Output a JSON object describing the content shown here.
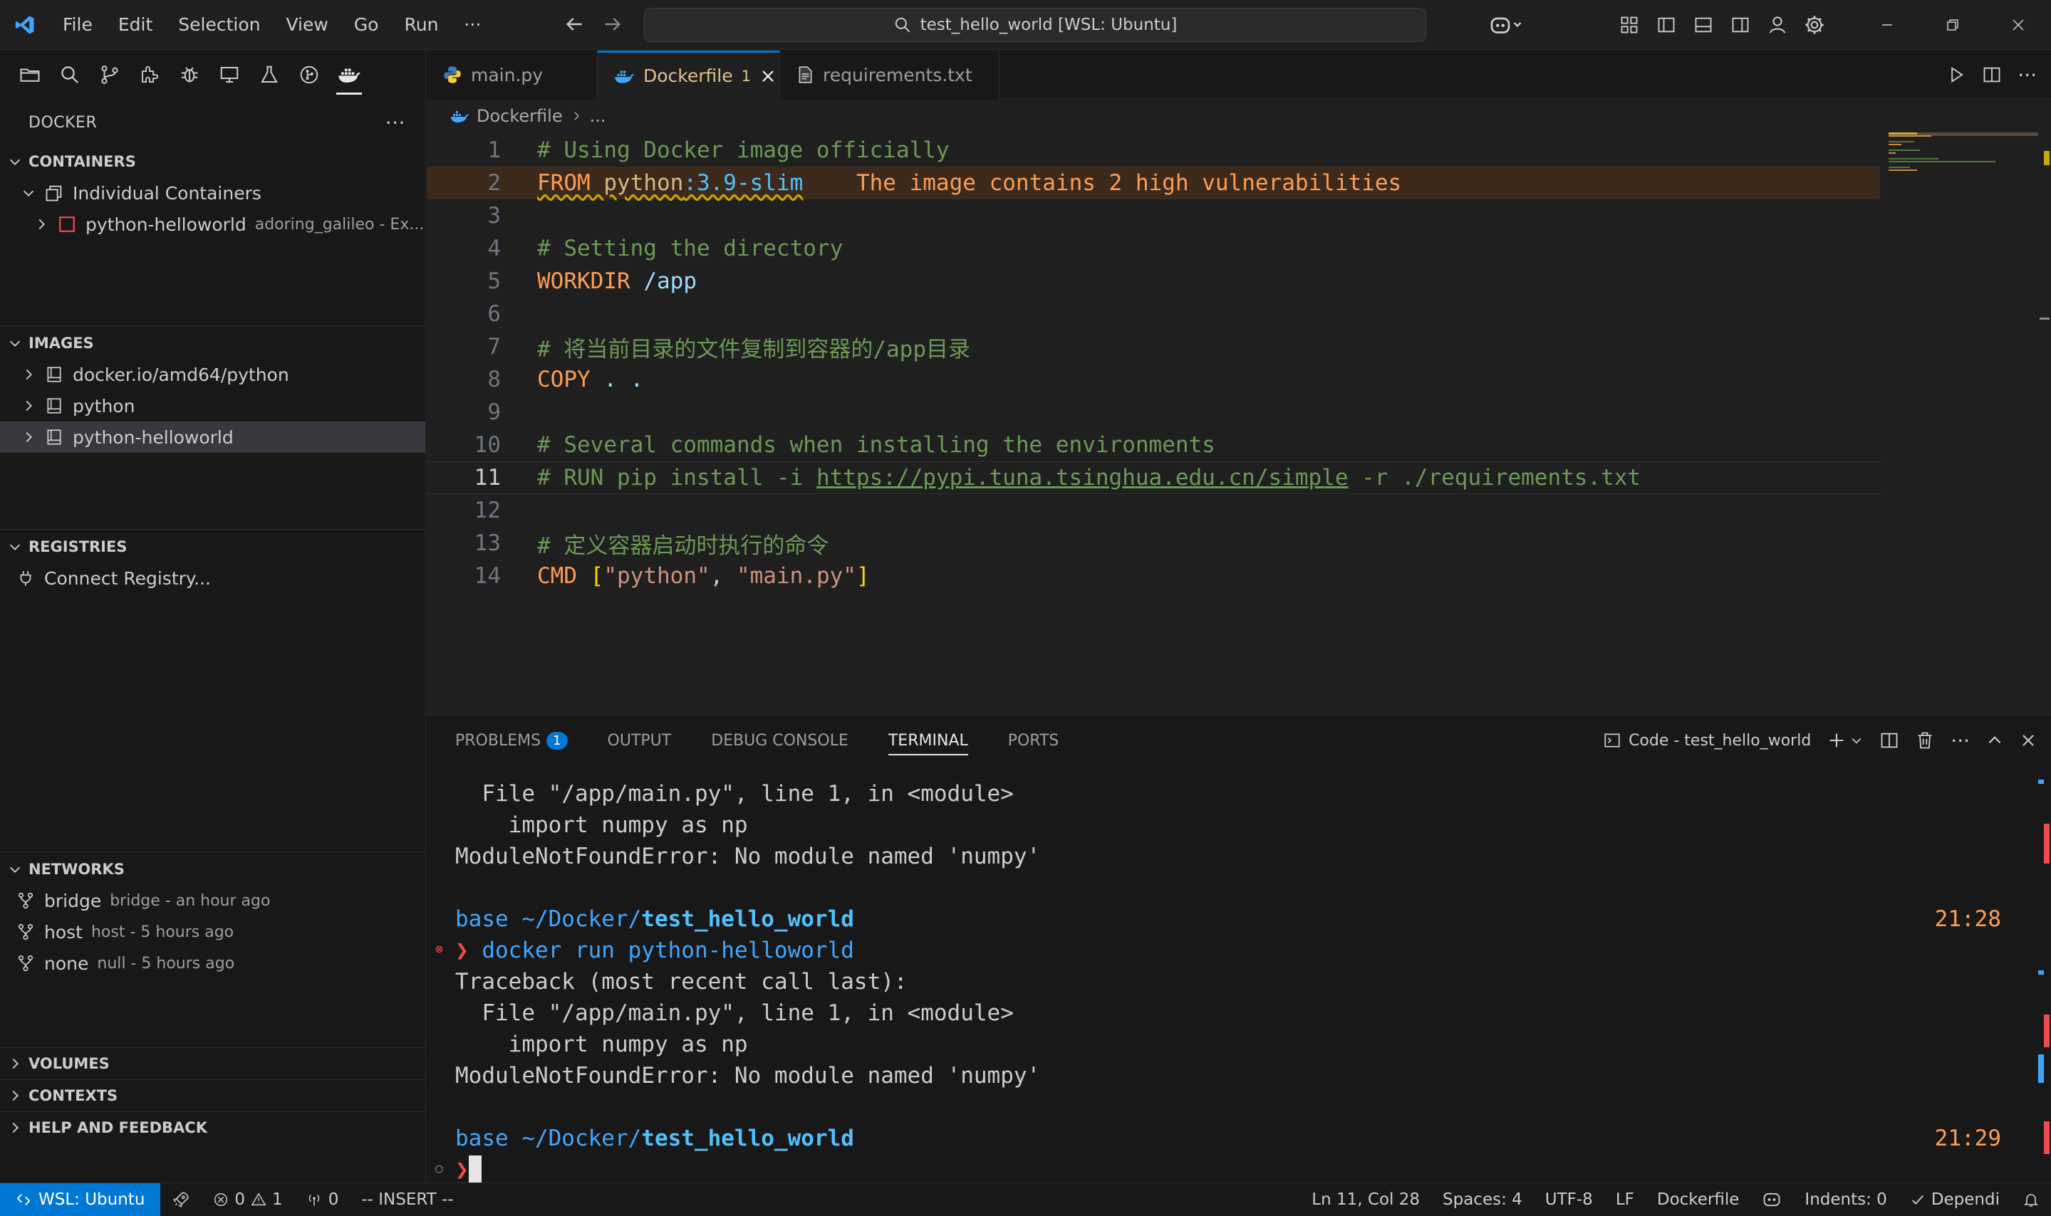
{
  "titlebar": {
    "menu": [
      "File",
      "Edit",
      "Selection",
      "View",
      "Go",
      "Run",
      "···"
    ],
    "search_text": "test_hello_world [WSL: Ubuntu]"
  },
  "sidebar": {
    "title": "DOCKER",
    "more": "···",
    "containers": {
      "header": "CONTAINERS",
      "group": "Individual Containers",
      "items": [
        {
          "name": "python-helloworld",
          "desc": "adoring_galileo - Ex..."
        }
      ]
    },
    "images": {
      "header": "IMAGES",
      "items": [
        "docker.io/amd64/python",
        "python",
        "python-helloworld"
      ]
    },
    "registries": {
      "header": "REGISTRIES",
      "connect": "Connect Registry..."
    },
    "networks": {
      "header": "NETWORKS",
      "items": [
        {
          "name": "bridge",
          "desc": "bridge - an hour ago"
        },
        {
          "name": "host",
          "desc": "host - 5 hours ago"
        },
        {
          "name": "none",
          "desc": "null - 5 hours ago"
        }
      ]
    },
    "volumes": "VOLUMES",
    "contexts": "CONTEXTS",
    "help": "HELP AND FEEDBACK"
  },
  "editor": {
    "tabs": [
      {
        "label": "main.py"
      },
      {
        "label": "Dockerfile",
        "badge": "1"
      },
      {
        "label": "requirements.txt"
      }
    ],
    "breadcrumb": {
      "file": "Dockerfile",
      "rest": "..."
    },
    "line_numbers": [
      "1",
      "2",
      "3",
      "4",
      "5",
      "6",
      "7",
      "8",
      "9",
      "10",
      "11",
      "12",
      "13",
      "14"
    ],
    "code": {
      "l1": "# Using Docker image officially",
      "l2_kw": "FROM",
      "l2_img": "python",
      "l2_tag": ":3.9-slim",
      "l2_inlay": "The image contains 2 high vulnerabilities",
      "l4": "# Setting the directory",
      "l5_kw": "WORKDIR",
      "l5_arg": "/app",
      "l7": "# 将当前目录的文件复制到容器的/app目录",
      "l8_kw": "COPY",
      "l8_arg": ". .",
      "l10": "# Several commands when installing the environments",
      "l11_a": "# RUN pip install -i ",
      "l11_url": "https://pypi.tuna.tsinghua.edu.cn/simple",
      "l11_b": " -r ./requirements.txt",
      "l13": "# 定义容器启动时执行的命令",
      "l14_kw": "CMD",
      "l14_open": "[",
      "l14_s1": "\"python\"",
      "l14_comma": ", ",
      "l14_s2": "\"main.py\"",
      "l14_close": "]"
    }
  },
  "panel": {
    "tabs": [
      "PROBLEMS",
      "OUTPUT",
      "DEBUG CONSOLE",
      "TERMINAL",
      "PORTS"
    ],
    "problems_count": "1",
    "terminal_name": "Code - test_hello_world",
    "terminal": {
      "l1": "  File \"/app/main.py\", line 1, in <module>",
      "l2": "    import numpy as np",
      "l3": "ModuleNotFoundError: No module named 'numpy'",
      "prompt_base": "base",
      "prompt_path": " ~/Docker/",
      "prompt_dir": "test_hello_world",
      "time1": "21:28",
      "prompt_char": "❯",
      "cmd": " docker run python-helloworld",
      "l6": "Traceback (most recent call last):",
      "l7": "  File \"/app/main.py\", line 1, in <module>",
      "l8": "    import numpy as np",
      "l9": "ModuleNotFoundError: No module named 'numpy'",
      "time2": "21:29"
    }
  },
  "statusbar": {
    "remote": "WSL: Ubuntu",
    "errors": "0",
    "warnings": "1",
    "ports": "0",
    "mode": "-- INSERT --",
    "position": "Ln 11, Col 28",
    "spaces": "Spaces: 4",
    "encoding": "UTF-8",
    "eol": "LF",
    "language": "Dockerfile",
    "indents": "Indents: 0",
    "depend": "Dependi"
  },
  "colors": {
    "accent": "#0078d4",
    "warning": "#ff9c50",
    "comment": "#6a9955",
    "error": "#f14c4c"
  }
}
